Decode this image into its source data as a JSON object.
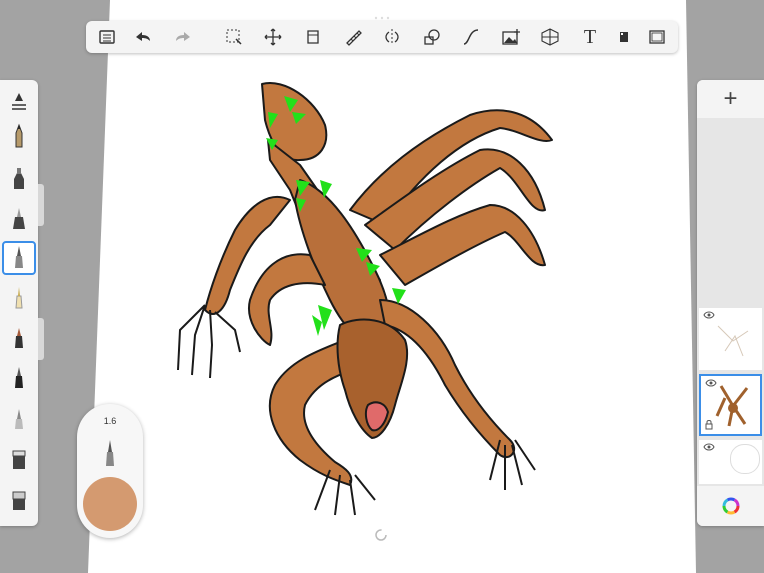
{
  "toolbar": {
    "buttons": [
      {
        "name": "list-icon"
      },
      {
        "name": "undo-icon"
      },
      {
        "name": "redo-icon"
      },
      {
        "name": "selection-icon"
      },
      {
        "name": "transform-icon"
      },
      {
        "name": "fill-icon"
      },
      {
        "name": "ruler-icon"
      },
      {
        "name": "symmetry-icon"
      },
      {
        "name": "shapes-icon"
      },
      {
        "name": "stroke-icon"
      },
      {
        "name": "image-icon"
      },
      {
        "name": "perspective-icon"
      },
      {
        "name": "text-icon",
        "glyph": "T"
      },
      {
        "name": "flipbook-icon"
      },
      {
        "name": "fullscreen-icon"
      }
    ]
  },
  "brushes": [
    {
      "name": "brush-settings-icon"
    },
    {
      "name": "pencil-icon"
    },
    {
      "name": "marker-icon"
    },
    {
      "name": "airbrush-icon"
    },
    {
      "name": "paint-brush-icon",
      "selected": true
    },
    {
      "name": "calligraphy-pen-icon"
    },
    {
      "name": "paint-tube-icon"
    },
    {
      "name": "ink-pen-icon"
    },
    {
      "name": "smudge-icon"
    },
    {
      "name": "eraser-icon"
    },
    {
      "name": "eraser-hard-icon"
    }
  ],
  "puck": {
    "size_value": "1.6",
    "color": "#d49a70"
  },
  "layers": [
    {
      "name": "layer-sketch"
    },
    {
      "name": "layer-painting",
      "active": true
    },
    {
      "name": "layer-background"
    }
  ],
  "colors": {
    "accent": "#3b8ee8",
    "canvas": "#ffffff",
    "background": "#a3a3a3",
    "monster_skin": "#c2783f",
    "monster_outline": "#1a1a1a",
    "monster_spikes": "#22e01a"
  }
}
